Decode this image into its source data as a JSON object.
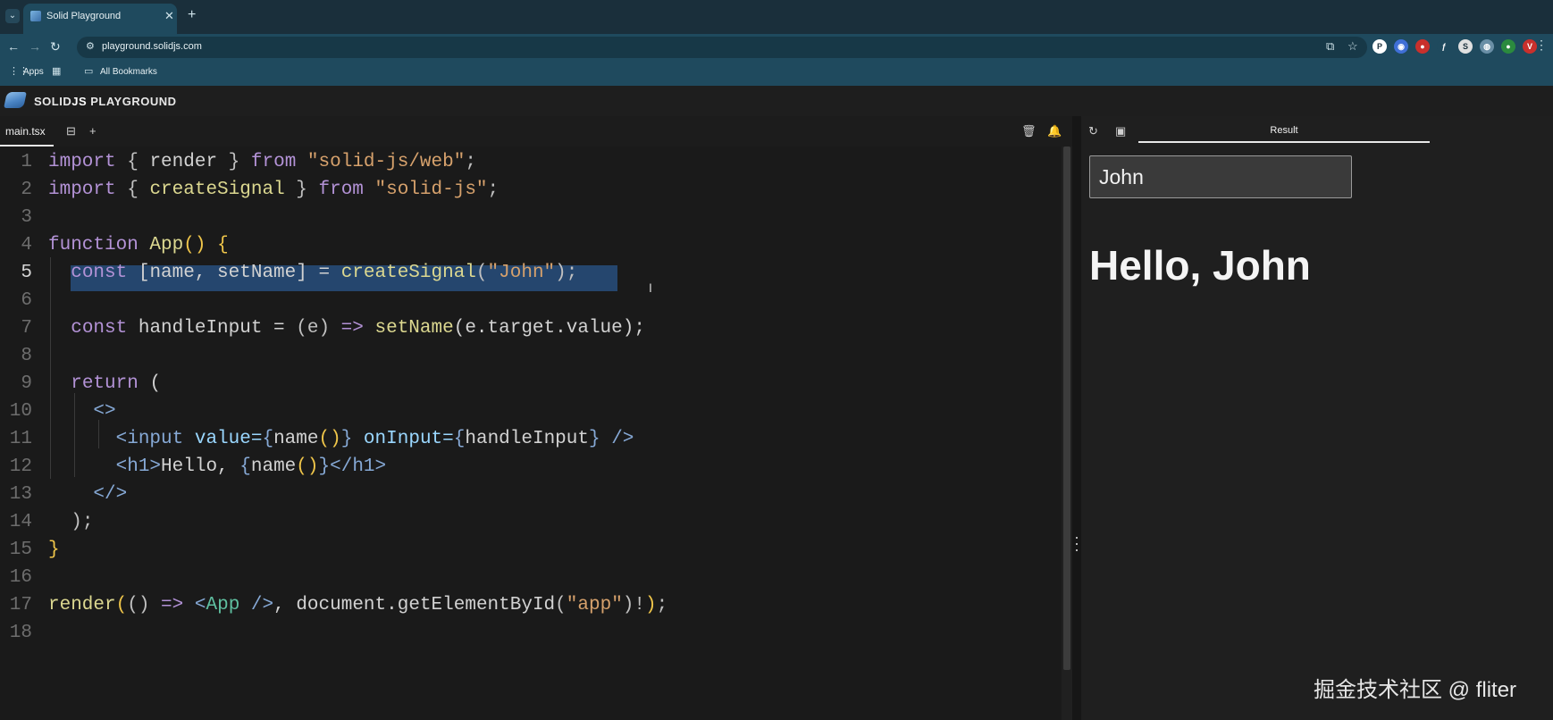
{
  "browser": {
    "tab_title": "Solid Playground",
    "url": "playground.solidjs.com",
    "bookmarks": [
      {
        "label": "Apps"
      },
      {
        "label": "All Bookmarks"
      }
    ],
    "extensions": [
      {
        "label": "P",
        "color": "#ffffff"
      },
      {
        "label": "◉",
        "color": "#3f6fd6"
      },
      {
        "label": "●",
        "color": "#c9302c"
      },
      {
        "label": "ƒ",
        "color": "#1f4a5e"
      },
      {
        "label": "S",
        "color": "#e0e0e0"
      },
      {
        "label": "◍",
        "color": "#6a8fa6"
      },
      {
        "label": "●",
        "color": "#2b8a3e"
      },
      {
        "label": "V",
        "color": "#c9302c"
      }
    ]
  },
  "app": {
    "title_prefix": "SOLID",
    "title_bold": "JS",
    "title_suffix": " PLAYGROUND"
  },
  "editor": {
    "file_tab": "main.tsx",
    "active_line": 5
  },
  "code": [
    [
      {
        "t": "import",
        "c": "kw"
      },
      {
        "t": " "
      },
      {
        "t": "{",
        "c": "punc"
      },
      {
        "t": " render ",
        "c": "var"
      },
      {
        "t": "}",
        "c": "punc"
      },
      {
        "t": " from ",
        "c": "kw"
      },
      {
        "t": "\"solid-js/web\"",
        "c": "str"
      },
      {
        "t": ";",
        "c": "punc"
      }
    ],
    [
      {
        "t": "import",
        "c": "kw"
      },
      {
        "t": " "
      },
      {
        "t": "{",
        "c": "punc"
      },
      {
        "t": " createSignal ",
        "c": "fn"
      },
      {
        "t": "}",
        "c": "punc"
      },
      {
        "t": " from ",
        "c": "kw"
      },
      {
        "t": "\"solid-js\"",
        "c": "str"
      },
      {
        "t": ";",
        "c": "punc"
      }
    ],
    [],
    [
      {
        "t": "function",
        "c": "kw"
      },
      {
        "t": " App",
        "c": "fn"
      },
      {
        "t": "()",
        "c": "brace"
      },
      {
        "t": " "
      },
      {
        "t": "{",
        "c": "brace"
      }
    ],
    [
      {
        "t": "  "
      },
      {
        "t": "const",
        "c": "kw"
      },
      {
        "t": " [name, setName] = ",
        "c": "var"
      },
      {
        "t": "createSignal",
        "c": "fn"
      },
      {
        "t": "(",
        "c": "punc"
      },
      {
        "t": "\"John\"",
        "c": "str"
      },
      {
        "t": ");",
        "c": "punc"
      }
    ],
    [],
    [
      {
        "t": "  "
      },
      {
        "t": "const",
        "c": "kw"
      },
      {
        "t": " handleInput = ",
        "c": "var"
      },
      {
        "t": "(e)",
        "c": "punc"
      },
      {
        "t": " => ",
        "c": "kw"
      },
      {
        "t": "setName",
        "c": "fn"
      },
      {
        "t": "(e.target.value);",
        "c": "var"
      }
    ],
    [],
    [
      {
        "t": "  "
      },
      {
        "t": "return",
        "c": "kw"
      },
      {
        "t": " ("
      }
    ],
    [
      {
        "t": "    "
      },
      {
        "t": "<>",
        "c": "tag"
      }
    ],
    [
      {
        "t": "      "
      },
      {
        "t": "<input",
        "c": "tag"
      },
      {
        "t": " value=",
        "c": "attr"
      },
      {
        "t": "{",
        "c": "tag"
      },
      {
        "t": "name",
        "c": "var"
      },
      {
        "t": "()",
        "c": "brace"
      },
      {
        "t": "}",
        "c": "tag"
      },
      {
        "t": " onInput=",
        "c": "attr"
      },
      {
        "t": "{",
        "c": "tag"
      },
      {
        "t": "handleInput",
        "c": "var"
      },
      {
        "t": "}",
        "c": "tag"
      },
      {
        "t": " />",
        "c": "tag"
      }
    ],
    [
      {
        "t": "      "
      },
      {
        "t": "<h1>",
        "c": "tag"
      },
      {
        "t": "Hello, ",
        "c": "var"
      },
      {
        "t": "{",
        "c": "tag"
      },
      {
        "t": "name",
        "c": "var"
      },
      {
        "t": "()",
        "c": "brace"
      },
      {
        "t": "}",
        "c": "tag"
      },
      {
        "t": "</h1>",
        "c": "tag"
      }
    ],
    [
      {
        "t": "    "
      },
      {
        "t": "</>",
        "c": "tag"
      }
    ],
    [
      {
        "t": "  "
      },
      {
        "t": ");",
        "c": "punc"
      }
    ],
    [
      {
        "t": "}",
        "c": "brace"
      }
    ],
    [],
    [
      {
        "t": "render",
        "c": "fn"
      },
      {
        "t": "(",
        "c": "brace"
      },
      {
        "t": "()",
        "c": "punc"
      },
      {
        "t": " => ",
        "c": "kw"
      },
      {
        "t": "<",
        "c": "tag"
      },
      {
        "t": "App",
        "c": "comp"
      },
      {
        "t": " />",
        "c": "tag"
      },
      {
        "t": ", document.getElementById",
        "c": "var"
      },
      {
        "t": "(",
        "c": "punc"
      },
      {
        "t": "\"app\"",
        "c": "str"
      },
      {
        "t": ")!",
        "c": "punc"
      },
      {
        "t": ")",
        "c": "brace"
      },
      {
        "t": ";",
        "c": "punc"
      }
    ],
    []
  ],
  "result": {
    "tab_label": "Result",
    "input_value": "John",
    "heading": "Hello, John"
  },
  "watermark": "掘金技术社区 @ fliter",
  "icons": {
    "tab_menu": "chevron-down-icon",
    "new_tab": "plus-icon",
    "back": "arrow-left-icon",
    "forward": "arrow-right-icon",
    "reload": "reload-icon",
    "delete": "trash-icon",
    "notify": "bell-icon"
  }
}
